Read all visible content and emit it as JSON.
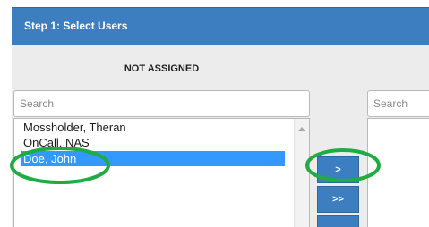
{
  "header": {
    "title": "Step 1: Select Users"
  },
  "panel": {
    "title": "NOT ASSIGNED"
  },
  "left": {
    "search_placeholder": "Search",
    "items": [
      {
        "label": "Mossholder, Theran",
        "selected": false
      },
      {
        "label": "OnCall, NAS",
        "selected": false
      },
      {
        "label": "Doe, John",
        "selected": true
      }
    ]
  },
  "buttons": {
    "move_selected": ">",
    "move_all": ">>"
  },
  "right": {
    "search_placeholder": "Search"
  },
  "colors": {
    "header": "#3d7ec0",
    "selection": "#3399ff",
    "annotation": "#22aa44"
  },
  "icons": {
    "scroll_up": "scroll-up-arrow-icon"
  }
}
